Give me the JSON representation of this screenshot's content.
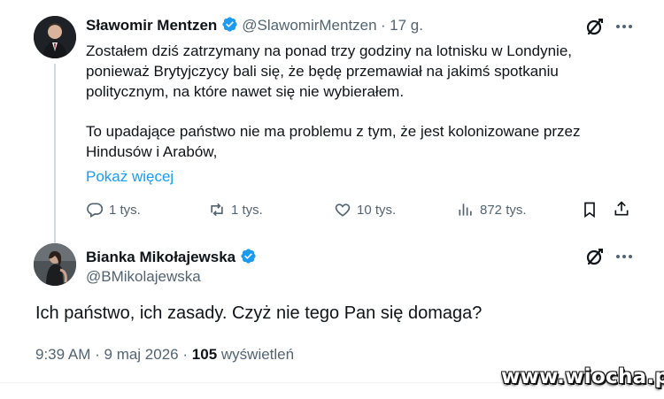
{
  "tweet1": {
    "author_name": "Sławomir Mentzen",
    "handle": "@SlawomirMentzen",
    "separator": "·",
    "time": "17 g.",
    "text_p1": "Zostałem dziś zatrzymany na ponad trzy godziny na lotnisku w Londynie, ponieważ Brytyjczycy bali się, że będę przemawiał na jakimś spotkaniu politycznym, na które nawet się nie wybierałem.",
    "text_p2": "To upadające państwo nie ma problemu z tym, że jest kolonizowane przez Hindusów i Arabów,",
    "show_more": "Pokaż więcej",
    "actions": {
      "replies": "1 tys.",
      "reposts": "1 tys.",
      "likes": "10 tys.",
      "views": "872 tys."
    }
  },
  "tweet2": {
    "author_name": "Bianka Mikołajewska",
    "handle": "@BMikolajewska",
    "text": "Ich państwo, ich zasady. Czyż nie tego Pan się domaga?",
    "time": "9:39 AM",
    "separator": "·",
    "date": "9 maj 2026",
    "separator2": "·",
    "views_count": "105",
    "views_label": "wyświetleń"
  },
  "watermark": "www.wiocha.pl",
  "colors": {
    "text": "#0f1419",
    "secondary": "#536471",
    "link": "#1d9bf0",
    "verified": "#1d9bf0"
  },
  "icons": [
    "grok-icon",
    "more-icon",
    "verified-icon",
    "reply-icon",
    "repost-icon",
    "like-icon",
    "views-icon",
    "bookmark-icon",
    "share-icon"
  ]
}
